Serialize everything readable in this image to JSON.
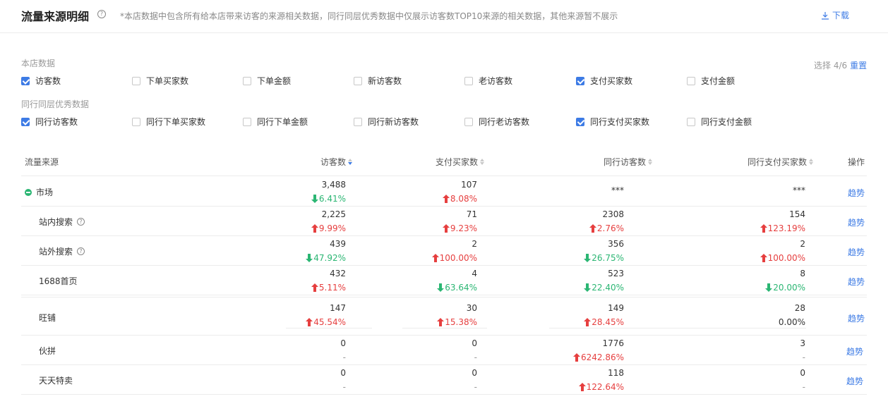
{
  "header": {
    "title": "流量来源明细",
    "help_glyph": "?",
    "note": "*本店数据中包含所有给本店带来访客的来源相关数据，同行同层优秀数据中仅展示访客数TOP10来源的相关数据，其他来源暂不展示",
    "download_label": "下载"
  },
  "filters": {
    "store_label": "本店数据",
    "peer_label": "同行同层优秀数据",
    "select_count": "选择 4/6",
    "reset_label": "重置",
    "store_metrics": [
      {
        "label": "访客数",
        "checked": true
      },
      {
        "label": "下单买家数",
        "checked": false
      },
      {
        "label": "下单金额",
        "checked": false
      },
      {
        "label": "新访客数",
        "checked": false
      },
      {
        "label": "老访客数",
        "checked": false
      },
      {
        "label": "支付买家数",
        "checked": true
      },
      {
        "label": "支付金额",
        "checked": false
      }
    ],
    "peer_metrics": [
      {
        "label": "同行访客数",
        "checked": true
      },
      {
        "label": "同行下单买家数",
        "checked": false
      },
      {
        "label": "同行下单金额",
        "checked": false
      },
      {
        "label": "同行新访客数",
        "checked": false
      },
      {
        "label": "同行老访客数",
        "checked": false
      },
      {
        "label": "同行支付买家数",
        "checked": true
      },
      {
        "label": "同行支付金额",
        "checked": false
      }
    ]
  },
  "table": {
    "columns": {
      "source": "流量来源",
      "visitors": "访客数",
      "pay_buyers": "支付买家数",
      "peer_visitors": "同行访客数",
      "peer_pay_buyers": "同行支付买家数",
      "action": "操作"
    },
    "trend_label": "趋势",
    "rows": [
      {
        "name": "市场",
        "visitors": "3,488",
        "visitors_chg": "6.41%",
        "visitors_dir": "down",
        "pay": "107",
        "pay_chg": "8.08%",
        "pay_dir": "up",
        "peer": "***",
        "peer_chg": "",
        "peer_dir": "none",
        "peer_pay": "***",
        "peer_pay_chg": "",
        "peer_pay_dir": "none"
      },
      {
        "name": "站内搜索",
        "visitors": "2,225",
        "visitors_chg": "9.99%",
        "visitors_dir": "up",
        "pay": "71",
        "pay_chg": "9.23%",
        "pay_dir": "up",
        "peer": "2308",
        "peer_chg": "2.76%",
        "peer_dir": "up",
        "peer_pay": "154",
        "peer_pay_chg": "123.19%",
        "peer_pay_dir": "up"
      },
      {
        "name": "站外搜索",
        "visitors": "439",
        "visitors_chg": "47.92%",
        "visitors_dir": "down",
        "pay": "2",
        "pay_chg": "100.00%",
        "pay_dir": "up",
        "peer": "356",
        "peer_chg": "26.75%",
        "peer_dir": "down",
        "peer_pay": "2",
        "peer_pay_chg": "100.00%",
        "peer_pay_dir": "up"
      },
      {
        "name": "1688首页",
        "visitors": "432",
        "visitors_chg": "5.11%",
        "visitors_dir": "up",
        "pay": "4",
        "pay_chg": "63.64%",
        "pay_dir": "down",
        "peer": "523",
        "peer_chg": "22.40%",
        "peer_dir": "down",
        "peer_pay": "8",
        "peer_pay_chg": "20.00%",
        "peer_pay_dir": "down"
      },
      {
        "name": "旺铺",
        "visitors": "147",
        "visitors_chg": "45.54%",
        "visitors_dir": "up",
        "pay": "30",
        "pay_chg": "15.38%",
        "pay_dir": "up",
        "peer": "149",
        "peer_chg": "28.45%",
        "peer_dir": "up",
        "peer_pay": "28",
        "peer_pay_chg": "0.00%",
        "peer_pay_dir": "flat"
      },
      {
        "name": "伙拼",
        "visitors": "0",
        "visitors_chg": "-",
        "visitors_dir": "na",
        "pay": "0",
        "pay_chg": "-",
        "pay_dir": "na",
        "peer": "1776",
        "peer_chg": "6242.86%",
        "peer_dir": "up",
        "peer_pay": "3",
        "peer_pay_chg": "-",
        "peer_pay_dir": "na"
      },
      {
        "name": "天天特卖",
        "visitors": "0",
        "visitors_chg": "-",
        "visitors_dir": "na",
        "pay": "0",
        "pay_chg": "-",
        "pay_dir": "na",
        "peer": "118",
        "peer_chg": "122.64%",
        "peer_dir": "up",
        "peer_pay": "0",
        "peer_pay_chg": "-",
        "peer_pay_dir": "na"
      }
    ]
  },
  "colors": {
    "accent": "#3d7be5",
    "up": "#e63f3f",
    "down": "#2bb673"
  }
}
